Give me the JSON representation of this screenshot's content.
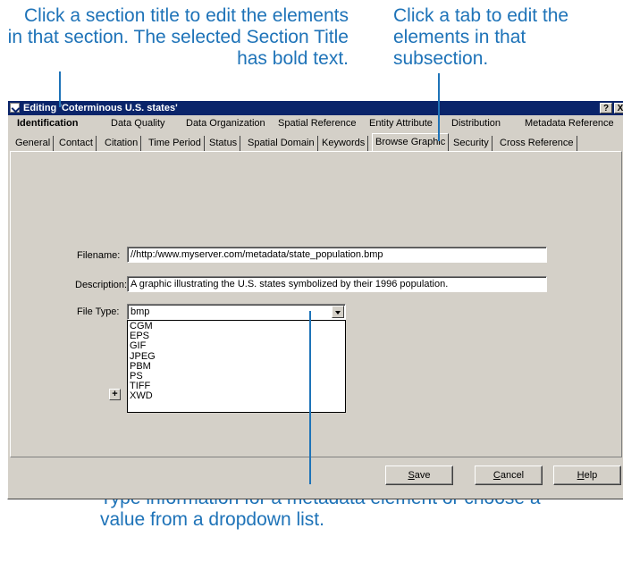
{
  "callouts": {
    "sections": "Click a section title to edit the elements in that section. The selected Section Title has bold text.",
    "tabs": "Click a tab to edit the elements in that subsection.",
    "field": "Type information for a metadata element or choose a value from a dropdown list."
  },
  "window": {
    "title": "Editing 'Coterminous U.S. states'",
    "help_button": "?",
    "close_button": "X"
  },
  "sections": [
    {
      "label": "Identification",
      "selected": true
    },
    {
      "label": "Data Quality"
    },
    {
      "label": "Data Organization"
    },
    {
      "label": "Spatial Reference"
    },
    {
      "label": "Entity Attribute"
    },
    {
      "label": "Distribution"
    },
    {
      "label": "Metadata Reference"
    }
  ],
  "tabs": [
    {
      "label": "General"
    },
    {
      "label": "Contact"
    },
    {
      "label": "Citation"
    },
    {
      "label": "Time Period"
    },
    {
      "label": "Status"
    },
    {
      "label": "Spatial Domain"
    },
    {
      "label": "Keywords"
    },
    {
      "label": "Browse Graphic",
      "active": true
    },
    {
      "label": "Security"
    },
    {
      "label": "Cross Reference"
    }
  ],
  "form": {
    "filename_label": "Filename:",
    "filename_value": "//http:/www.myserver.com/metadata/state_population.bmp",
    "description_label": "Description:",
    "description_value": "A graphic illustrating the U.S. states symbolized by their 1996 population.",
    "filetype_label": "File Type:",
    "filetype_value": "bmp",
    "filetype_options": [
      "CGM",
      "EPS",
      "GIF",
      "JPEG",
      "PBM",
      "PS",
      "TIFF",
      "XWD"
    ],
    "add_button": "+"
  },
  "buttons": {
    "save": {
      "underline": "S",
      "rest": "ave"
    },
    "cancel": {
      "underline": "C",
      "rest": "ancel"
    },
    "help": {
      "underline": "H",
      "rest": "elp"
    }
  }
}
